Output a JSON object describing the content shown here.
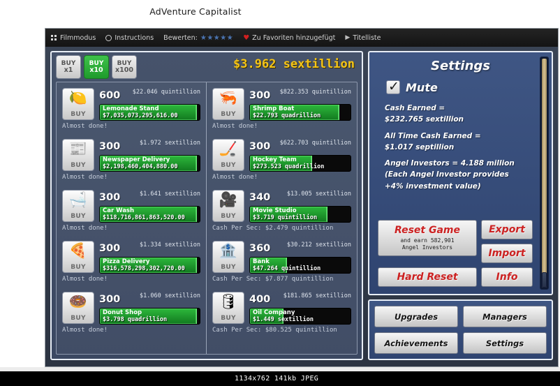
{
  "page": {
    "title": "AdVenture Capitalist"
  },
  "toolbar": {
    "film_mode": "Filmmodus",
    "instructions": "Instructions",
    "rate_label": "Bewerten:",
    "stars": "★★★★★",
    "favorite": "Zu Favoriten hinzugefügt",
    "title_list": "Titelliste"
  },
  "game": {
    "buy_multipliers": [
      {
        "top": "BUY",
        "bottom": "x1",
        "active": false
      },
      {
        "top": "BUY",
        "bottom": "x10",
        "active": true
      },
      {
        "top": "BUY",
        "bottom": "x100",
        "active": false
      }
    ],
    "cash_total": "$3.962 sextillion",
    "buy_word": "BUY",
    "businesses_left": [
      {
        "name": "Lemonade Stand",
        "icon": "lemon-icon",
        "glyph": "🍋",
        "qty": "600",
        "cost": "$22.046 quintillion",
        "revenue": "$7,035,073,295,616.00",
        "progress": 97,
        "status": "Almost done!"
      },
      {
        "name": "Newspaper Delivery",
        "icon": "newspaper-icon",
        "glyph": "📰",
        "qty": "300",
        "cost": "$1.972 sextillion",
        "revenue": "$2,198,460,404,880.00",
        "progress": 97,
        "status": "Almost done!"
      },
      {
        "name": "Car Wash",
        "icon": "carwash-icon",
        "glyph": "🛁",
        "qty": "300",
        "cost": "$1.641 sextillion",
        "revenue": "$118,716,861,863,520.00",
        "progress": 97,
        "status": "Almost done!"
      },
      {
        "name": "Pizza Delivery",
        "icon": "pizza-icon",
        "glyph": "🍕",
        "qty": "300",
        "cost": "$1.334 sextillion",
        "revenue": "$316,578,298,302,720.00",
        "progress": 97,
        "status": "Almost done!"
      },
      {
        "name": "Donut Shop",
        "icon": "donut-icon",
        "glyph": "🍩",
        "qty": "300",
        "cost": "$1.060 sextillion",
        "revenue": "$3.798 quadrillion",
        "progress": 97,
        "status": "Almost done!"
      }
    ],
    "businesses_right": [
      {
        "name": "Shrimp Boat",
        "icon": "shrimp-icon",
        "glyph": "🦐",
        "qty": "300",
        "cost": "$822.353 quintillion",
        "revenue": "$22.793 quadrillion",
        "progress": 89,
        "status": "Almost done!"
      },
      {
        "name": "Hockey Team",
        "icon": "hockey-icon",
        "glyph": "🏒",
        "qty": "300",
        "cost": "$622.703 quintillion",
        "revenue": "$273.523 quadrillion",
        "progress": 62,
        "status": "Almost done!"
      },
      {
        "name": "Movie Studio",
        "icon": "movie-camera-icon",
        "glyph": "🎥",
        "qty": "340",
        "cost": "$13.005 sextillion",
        "revenue": "$3.719 quintillion",
        "progress": 77,
        "status": "Cash Per Sec: $2.479 quintillion"
      },
      {
        "name": "Bank",
        "icon": "bank-icon",
        "glyph": "🏦",
        "qty": "360",
        "cost": "$30.212 sextillion",
        "revenue": "$47.264 quintillion",
        "progress": 37,
        "status": "Cash Per Sec: $7.877 quintillion"
      },
      {
        "name": "Oil Company",
        "icon": "oil-rig-icon",
        "glyph": "🛢",
        "qty": "400",
        "cost": "$181.865 sextillion",
        "revenue": "$1.449 sextillion",
        "progress": 33,
        "status": "Cash Per Sec: $80.525 quintillion"
      }
    ]
  },
  "settings": {
    "title": "Settings",
    "mute_label": "Mute",
    "mute_checked": true,
    "stats": [
      "Cash Earned =",
      "$232.765 sextillion",
      "All Time Cash Earned =",
      "$1.017 septillion",
      "Angel Investors = 4.188 million",
      "(Each Angel Investor provides",
      "+4% investment value)"
    ],
    "reset_game_label": "Reset Game",
    "reset_game_sub_line1": "and earn 582,901",
    "reset_game_sub_line2": "Angel Investors",
    "hard_reset_label": "Hard Reset",
    "export_label": "Export",
    "import_label": "Import",
    "info_label": "Info"
  },
  "nav": {
    "upgrades": "Upgrades",
    "managers": "Managers",
    "achievements": "Achievements",
    "settings": "Settings"
  },
  "caption": {
    "text": "1134x762  141kb  JPEG"
  },
  "colors": {
    "accent_cash": "#f5c518",
    "progress_green": "#2db83c",
    "panel_blue": "#3f5684",
    "danger_red": "#cc2222"
  }
}
